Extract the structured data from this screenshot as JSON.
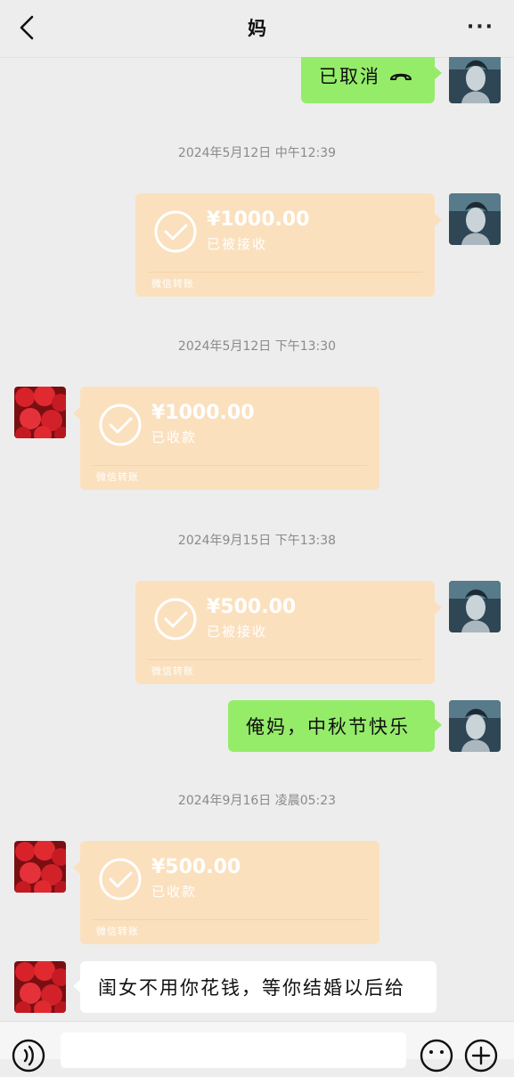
{
  "header": {
    "title": "妈",
    "back_icon": "chevron-left-icon",
    "more_label": "···"
  },
  "colors": {
    "my_bubble": "#95ec69",
    "transfer": "#fbe0be",
    "background": "#ededed"
  },
  "messages": [
    {
      "type": "text",
      "side": "right",
      "text": "已取消",
      "icon": "phone-hangup-icon"
    },
    {
      "type": "timestamp",
      "text": "2024年5月12日 中午12:39"
    },
    {
      "type": "transfer",
      "side": "right",
      "amount": "¥1000.00",
      "status": "已被接收",
      "footer": "微信转账"
    },
    {
      "type": "timestamp",
      "text": "2024年5月12日 下午13:30"
    },
    {
      "type": "transfer",
      "side": "left",
      "amount": "¥1000.00",
      "status": "已收款",
      "footer": "微信转账"
    },
    {
      "type": "timestamp",
      "text": "2024年9月15日 下午13:38"
    },
    {
      "type": "transfer",
      "side": "right",
      "amount": "¥500.00",
      "status": "已被接收",
      "footer": "微信转账"
    },
    {
      "type": "text",
      "side": "right",
      "text": "俺妈，中秋节快乐"
    },
    {
      "type": "timestamp",
      "text": "2024年9月16日 凌晨05:23"
    },
    {
      "type": "transfer",
      "side": "left",
      "amount": "¥500.00",
      "status": "已收款",
      "footer": "微信转账"
    },
    {
      "type": "text",
      "side": "left",
      "text": "闺女不用你花钱，等你结婚以后给"
    }
  ],
  "input_bar": {
    "voice_icon": "voice-icon",
    "emoji_icon": "emoji-icon",
    "plus_icon": "plus-icon"
  }
}
